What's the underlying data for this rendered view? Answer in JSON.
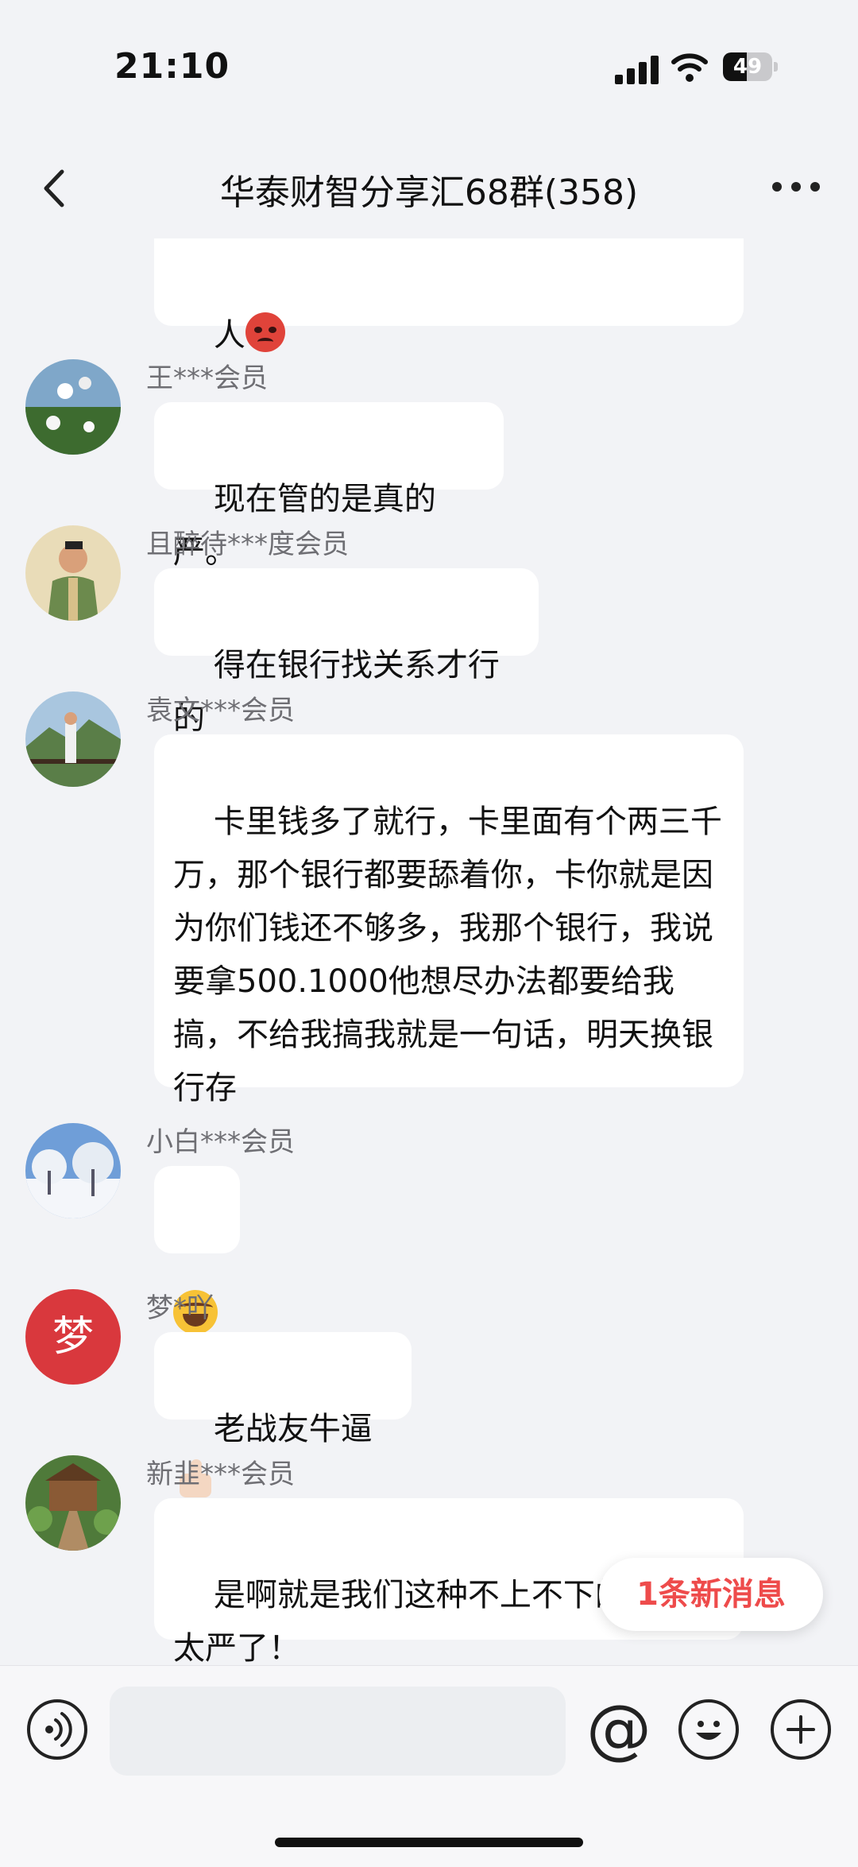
{
  "status_bar": {
    "time": "21:10",
    "battery": "49",
    "battery_level": 0.49
  },
  "header": {
    "title": "华泰财智分享汇68群(358)",
    "back_icon": "chevron-left-icon",
    "more_icon": "more-dots-icon"
  },
  "messages": [
    {
      "sender": "",
      "text": "人",
      "emoji": "angry-face"
    },
    {
      "sender": "王***会员",
      "text": "现在管的是真的严。"
    },
    {
      "sender": "且醉待***度会员",
      "text": "得在银行找关系才行的"
    },
    {
      "sender": "袁文***会员",
      "text": "卡里钱多了就行，卡里面有个两三千万，那个银行都要舔着你，卡你就是因为你们钱还不够多，我那个银行，我说要拿500.1000他想尽办法都要给我搞，不给我搞我就是一句话，明天换银行存"
    },
    {
      "sender": "小白***会员",
      "text": "",
      "emoji": "laughing-tears"
    },
    {
      "sender": "梦*吖",
      "avatar_text": "梦",
      "text": "老战友牛逼",
      "emoji": "thumbs-up"
    },
    {
      "sender": "新韭***会员",
      "text": "是啊就是我们这种不上不下的，管的太严了！"
    }
  ],
  "new_message_pill": "1条新消息",
  "input_bar": {
    "placeholder": "",
    "at_label": "@",
    "icons": [
      "voice-icon",
      "emoji-icon",
      "plus-icon"
    ]
  },
  "colors": {
    "background": "#f2f3f6",
    "bubble": "#ffffff",
    "accent_red": "#ee4b4b",
    "avatar_red": "#d9383d"
  }
}
